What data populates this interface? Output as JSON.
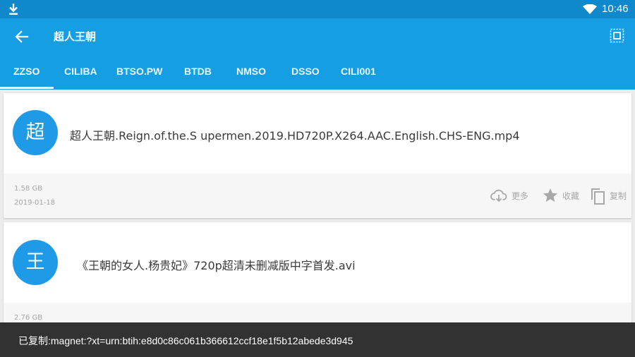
{
  "status_bar": {
    "time": "10:46",
    "icons": [
      "download-icon",
      "wifi-icon"
    ]
  },
  "app_bar": {
    "title": "超人王朝",
    "icons": [
      "back-arrow-icon",
      "select-all-icon"
    ]
  },
  "tabs": [
    {
      "label": "ZZSO",
      "active": true
    },
    {
      "label": "CILIBA"
    },
    {
      "label": "BTSO.PW"
    },
    {
      "label": "BTDB"
    },
    {
      "label": "NMSO"
    },
    {
      "label": "DSSO"
    },
    {
      "label": "CILI001"
    }
  ],
  "colors": {
    "status_bar": "#0f89cb",
    "app_bar": "#169ee3",
    "avatar": "#1f9ae6",
    "snackbar": "#323232"
  },
  "results": [
    {
      "avatar_char": "超",
      "name": "超人王朝.Reign.of.the.S upermen.2019.HD720P.X264.AAC.English.CHS-ENG.mp4",
      "size": "1.58 GB",
      "date": "2019-01-18",
      "actions": {
        "more": "更多",
        "favorite": "收藏",
        "copy": "复制"
      }
    },
    {
      "avatar_char": "王",
      "name": "《王朝的女人.杨贵妃》720p超清未删减版中字首发.avi",
      "size": "2.76 GB"
    }
  ],
  "snackbar": {
    "message": "已复制:magnet:?xt=urn:btih:e8d0c86c061b366612ccf18e1f5b12abede3d945"
  }
}
